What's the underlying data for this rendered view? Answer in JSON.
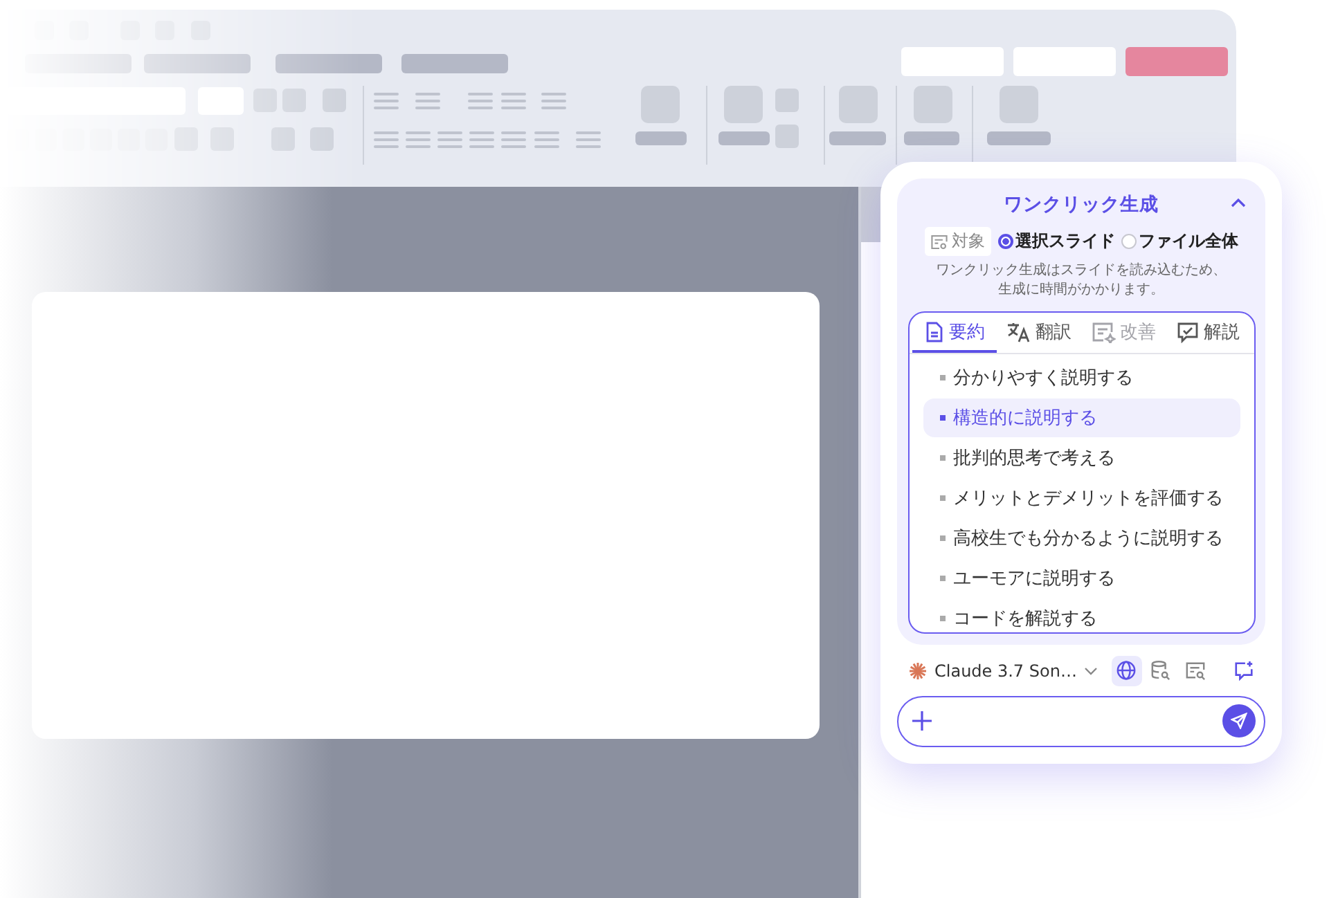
{
  "assistant": {
    "title": "ワンクリック生成",
    "target": {
      "label": "対象",
      "options": [
        {
          "label": "選択スライド",
          "selected": true
        },
        {
          "label": "ファイル全体",
          "selected": false
        }
      ]
    },
    "notice": "ワンクリック生成はスライドを読み込むため、生成に時間がかかります。",
    "tabs": [
      {
        "label": "要約",
        "selected": true,
        "disabled": false
      },
      {
        "label": "翻訳",
        "selected": false,
        "disabled": false
      },
      {
        "label": "改善",
        "selected": false,
        "disabled": true
      },
      {
        "label": "解説",
        "selected": false,
        "disabled": false
      }
    ],
    "prompts": [
      {
        "label": "分かりやすく説明する",
        "selected": false
      },
      {
        "label": "構造的に説明する",
        "selected": true
      },
      {
        "label": "批判的思考で考える",
        "selected": false
      },
      {
        "label": "メリットとデメリットを評価する",
        "selected": false
      },
      {
        "label": "高校生でも分かるように説明する",
        "selected": false
      },
      {
        "label": "ユーモアに説明する",
        "selected": false
      },
      {
        "label": "コードを解説する",
        "selected": false
      }
    ],
    "model": {
      "name": "Claude 3.7 Son…"
    },
    "tools": [
      {
        "selected": true
      },
      {
        "selected": false
      },
      {
        "selected": false
      }
    ]
  }
}
